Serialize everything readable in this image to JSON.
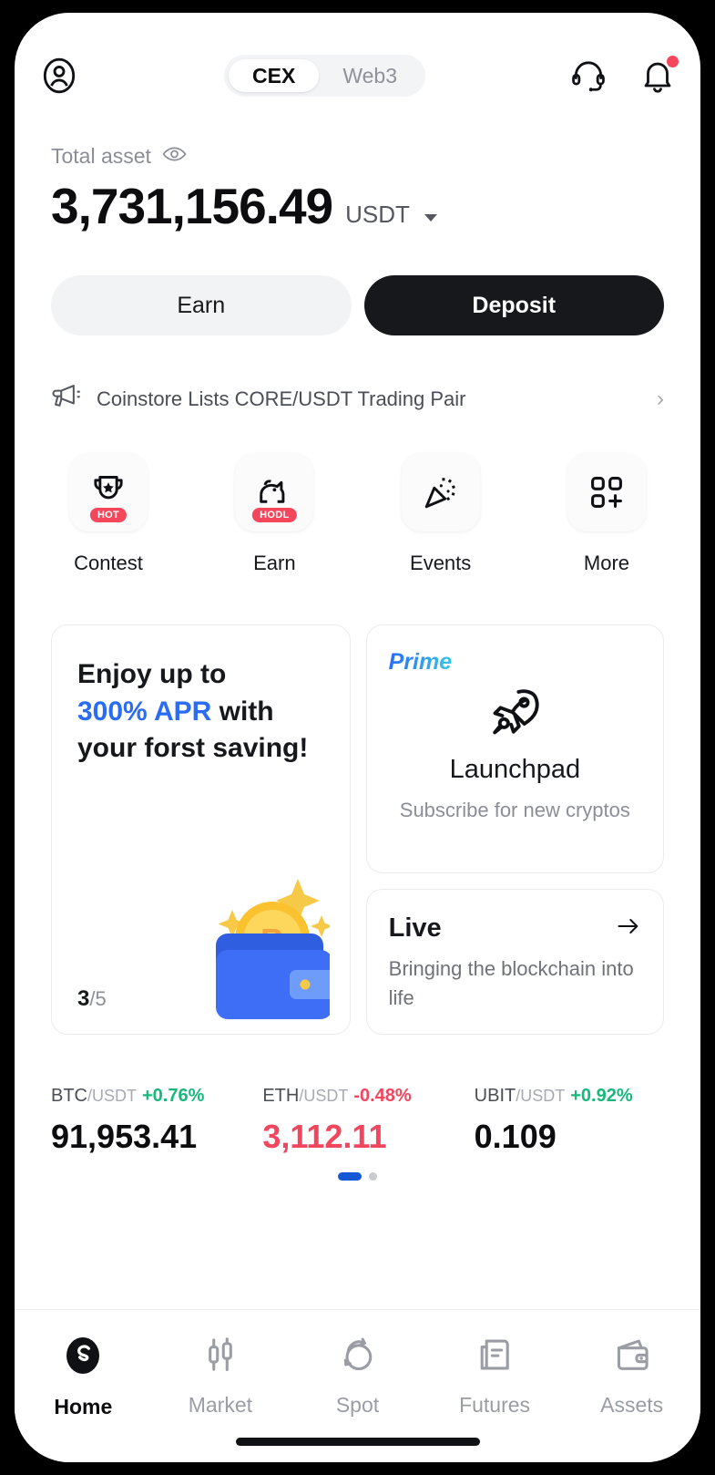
{
  "header": {
    "profile_icon": "user-circle-icon",
    "support_icon": "headset-icon",
    "notification_icon": "bell-icon",
    "segments": [
      {
        "label": "CEX",
        "active": true
      },
      {
        "label": "Web3",
        "active": false
      }
    ]
  },
  "balance": {
    "label": "Total asset",
    "eye_icon": "eye-icon",
    "amount": "3,731,156.49",
    "currency": "USDT",
    "caret_icon": "chevron-down-icon"
  },
  "actions": {
    "earn_label": "Earn",
    "deposit_label": "Deposit"
  },
  "announcement": {
    "icon": "megaphone-icon",
    "text": "Coinstore Lists CORE/USDT Trading Pair",
    "chevron": "›"
  },
  "quick_actions": [
    {
      "label": "Contest",
      "icon": "trophy-icon",
      "badge": "HOT"
    },
    {
      "label": "Earn",
      "icon": "piggy-bank-icon",
      "badge": "HODL"
    },
    {
      "label": "Events",
      "icon": "party-popper-icon",
      "badge": ""
    },
    {
      "label": "More",
      "icon": "grid-plus-icon",
      "badge": ""
    }
  ],
  "promo_card": {
    "line1": "Enjoy up to",
    "accent": "300% APR",
    "line2_rest": " with",
    "line3": "your forst saving!",
    "counter_current": "3",
    "counter_total": "/5",
    "art_icon": "wallet-bitcoin-icon"
  },
  "prime_card": {
    "tag": "Prime",
    "icon": "rocket-icon",
    "title": "Launchpad",
    "subtitle": "Subscribe for new cryptos"
  },
  "live_card": {
    "title": "Live",
    "arrow_icon": "arrow-right-icon",
    "subtitle": "Bringing the blockchain into life"
  },
  "tickers": [
    {
      "base": "BTC",
      "quote": "/USDT",
      "change": "+0.76%",
      "direction": "up",
      "price": "91,953.41"
    },
    {
      "base": "ETH",
      "quote": "/USDT",
      "change": "-0.48%",
      "direction": "down",
      "price": "3,112.11"
    },
    {
      "base": "UBIT",
      "quote": "/USDT",
      "change": "+0.92%",
      "direction": "up",
      "price": "0.109"
    }
  ],
  "ticker_pagination": {
    "total": 2,
    "active_index": 0
  },
  "bottom_nav": [
    {
      "label": "Home",
      "icon": "home-logo-icon",
      "active": true
    },
    {
      "label": "Market",
      "icon": "candlestick-icon",
      "active": false
    },
    {
      "label": "Spot",
      "icon": "spot-swap-icon",
      "active": false
    },
    {
      "label": "Futures",
      "icon": "futures-document-icon",
      "active": false
    },
    {
      "label": "Assets",
      "icon": "wallet-icon",
      "active": false
    }
  ],
  "colors": {
    "accent_blue": "#2b6cf5",
    "up_green": "#18b87b",
    "down_red": "#f0465e",
    "badge_red": "#f5475c",
    "dark": "#0d0d0f"
  }
}
